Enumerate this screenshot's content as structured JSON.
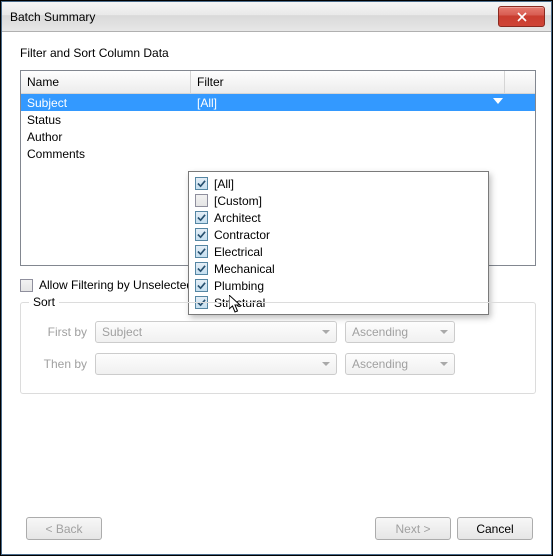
{
  "window": {
    "title": "Batch Summary"
  },
  "section": {
    "heading": "Filter and Sort Column Data"
  },
  "table": {
    "headers": {
      "name": "Name",
      "filter": "Filter"
    },
    "rows": [
      {
        "name": "Subject",
        "filter": "[All]",
        "selected": true
      },
      {
        "name": "Status",
        "filter": ""
      },
      {
        "name": "Author",
        "filter": ""
      },
      {
        "name": "Comments",
        "filter": ""
      }
    ]
  },
  "filter_dropdown": {
    "items": [
      {
        "label": "[All]",
        "checked": true
      },
      {
        "label": "[Custom]",
        "checked": false
      },
      {
        "label": "Architect",
        "checked": true
      },
      {
        "label": "Contractor",
        "checked": true
      },
      {
        "label": "Electrical",
        "checked": true
      },
      {
        "label": "Mechanical",
        "checked": true
      },
      {
        "label": "Plumbing",
        "checked": true
      },
      {
        "label": "Structural",
        "checked": true
      }
    ]
  },
  "options": {
    "allow_filtering_label": "Allow Filtering by Unselected Columns",
    "allow_filtering_checked": false
  },
  "sort": {
    "legend": "Sort",
    "first_by_label": "First by",
    "then_by_label": "Then by",
    "first_by_value": "Subject",
    "first_by_order": "Ascending",
    "then_by_value": "",
    "then_by_order": "Ascending"
  },
  "buttons": {
    "back": "< Back",
    "next": "Next >",
    "cancel": "Cancel"
  }
}
